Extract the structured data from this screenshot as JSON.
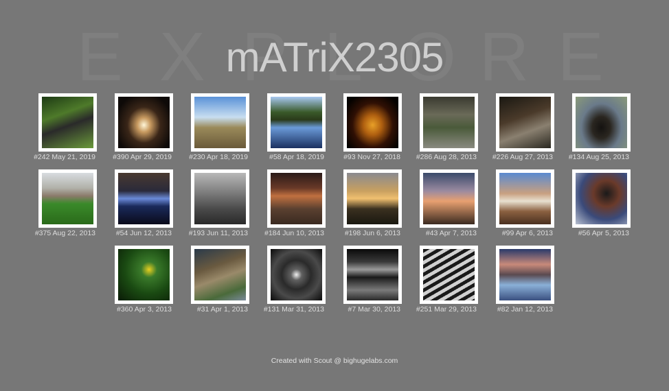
{
  "header": {
    "background_word_letters": [
      "E",
      "X",
      "P",
      "L",
      "O",
      "R",
      "E"
    ],
    "title": "mATriX2305"
  },
  "photos": [
    {
      "caption": "#242 May 21, 2019",
      "subject": "bicycles in greenery"
    },
    {
      "caption": "#390 Apr 29, 2019",
      "subject": "dark tunnel with light"
    },
    {
      "caption": "#230 Apr 18, 2019",
      "subject": "field under blue sky"
    },
    {
      "caption": "#58 Apr 18, 2019",
      "subject": "lake reflection"
    },
    {
      "caption": "#93 Nov 27, 2018",
      "subject": "illuminated windmill pyramid"
    },
    {
      "caption": "#286 Aug 28, 2013",
      "subject": "abandoned overgrown building"
    },
    {
      "caption": "#226 Aug 27, 2013",
      "subject": "graffiti ruin interior"
    },
    {
      "caption": "#134 Aug 25, 2013",
      "subject": "graffiti bunker entrance"
    },
    {
      "caption": "#375 Aug 22, 2013",
      "subject": "castle with flowers"
    },
    {
      "caption": "#54 Jun 12, 2013",
      "subject": "night harbor lights"
    },
    {
      "caption": "#193 Jun 11, 2013",
      "subject": "round buildings by water"
    },
    {
      "caption": "#184 Jun 10, 2013",
      "subject": "cobblestone square at dusk"
    },
    {
      "caption": "#198 Jun 6, 2013",
      "subject": "sunset over sea"
    },
    {
      "caption": "#43 Apr 7, 2013",
      "subject": "steel frame silhouette"
    },
    {
      "caption": "#99 Apr 6, 2013",
      "subject": "curved steps at sunset"
    },
    {
      "caption": "#56 Apr 5, 2013",
      "subject": "ruined brick arch"
    },
    {
      "caption": "#360 Apr 3, 2013",
      "subject": "poison dart frog on leaves"
    },
    {
      "caption": "#31 Apr 1, 2013",
      "subject": "tree stump close-up"
    },
    {
      "caption": "#131 Mar 31, 2013",
      "subject": "circular tunnel"
    },
    {
      "caption": "#7 Mar 30, 2013",
      "subject": "parking garage"
    },
    {
      "caption": "#251 Mar 29, 2013",
      "subject": "facade pattern"
    },
    {
      "caption": "#82 Jan 12, 2013",
      "subject": "river at dusk"
    }
  ],
  "footer": {
    "text": "Created with Scout @ bighugelabs.com"
  },
  "colors": {
    "background": "#777777",
    "title": "#cfcfcf",
    "background_word": "#7f7f7f",
    "caption": "#dddddd"
  }
}
